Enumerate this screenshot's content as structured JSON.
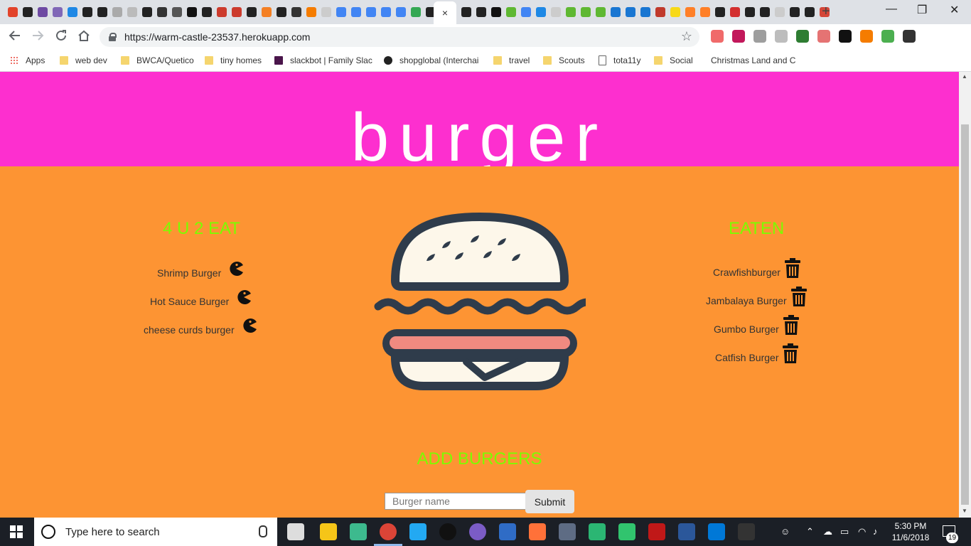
{
  "browser": {
    "url": "https://warm-castle-23537.herokuapp.com",
    "close_tab_glyph": "×",
    "new_tab_glyph": "+",
    "window_controls": {
      "minimize": "—",
      "maximize": "❐",
      "close": "✕"
    },
    "tab_favicon_colors": [
      "#e2432a",
      "#222222",
      "#6e4aa3",
      "#8067b7",
      "#1e88e5",
      "#222222",
      "#222222",
      "#aaaaaa",
      "#bbbbbb",
      "#222222",
      "#333333",
      "#555555",
      "#111111",
      "#222222",
      "#cc3b2d",
      "#cc3b2d",
      "#222222",
      "#f48024",
      "#222222",
      "#333333",
      "#f57c00",
      "#cccccc",
      "#4285f4",
      "#4285f4",
      "#4285f4",
      "#4285f4",
      "#4285f4",
      "#34a853",
      "#222222"
    ],
    "tab_favicon_colors_right": [
      "#222222",
      "#222222",
      "#111111",
      "#5fb832",
      "#4285f4",
      "#1e88e5",
      "#cccccc",
      "#5fb832",
      "#5fb832",
      "#5fb832",
      "#1976d2",
      "#1976d2",
      "#1976d2",
      "#c0392b",
      "#f7d918",
      "#ff7f27",
      "#ff7f27",
      "#222222",
      "#d32f2f",
      "#222222",
      "#222222",
      "#cccccc",
      "#222222",
      "#222222",
      "#d44638"
    ],
    "extension_colors": [
      "#f06a6a",
      "#c2185b",
      "#9e9e9e",
      "#bdbdbd",
      "#2e7d32",
      "#e57373",
      "#111111",
      "#f57c00",
      "#4caf50",
      "#333333"
    ],
    "bookmarks": [
      {
        "label": "Apps",
        "type": "apps"
      },
      {
        "label": "web dev",
        "type": "folder"
      },
      {
        "label": "BWCA/Quetico",
        "type": "folder"
      },
      {
        "label": "tiny homes",
        "type": "folder"
      },
      {
        "label": "slackbot | Family Slac",
        "type": "slack"
      },
      {
        "label": "shopglobal (Interchai",
        "type": "github"
      },
      {
        "label": "travel",
        "type": "folder"
      },
      {
        "label": "Scouts",
        "type": "folder"
      },
      {
        "label": "tota11y",
        "type": "page"
      },
      {
        "label": "Social",
        "type": "folder"
      },
      {
        "label": "Christmas Land and C",
        "type": "none"
      }
    ]
  },
  "page": {
    "title": "burger",
    "uneaten_heading": "4 U 2 EAT",
    "eaten_heading": "EATEN",
    "uneaten": [
      "Shrimp Burger",
      "Hot Sauce Burger",
      "cheese curds burger"
    ],
    "eaten": [
      "Crawfishburger",
      "Jambalaya Burger",
      "Gumbo Burger",
      "Catfish Burger"
    ],
    "add_heading": "ADD BURGERS",
    "input_placeholder": "Burger name",
    "submit_label": "Submit",
    "colors": {
      "jumbotron": "#fd2fcf",
      "main_bg": "#fd9433",
      "heading": "#7cfc00"
    },
    "icons": {
      "eat": "pacman-icon",
      "delete": "trash-icon",
      "hero": "burger-illustration"
    }
  },
  "taskbar": {
    "search_placeholder": "Type here to search",
    "time": "5:30 PM",
    "date": "11/6/2018",
    "notification_count": "19",
    "pinned_app_colors": [
      "#dddddd",
      "#f5c518",
      "#3dba8e",
      "#db4437",
      "#23a9f2",
      "#111111",
      "#7b5cc6",
      "#2f6cc6",
      "#ff7139",
      "#5e6c84",
      "#2bb673",
      "#31c46e",
      "#c01818",
      "#2b579a",
      "#0078d7",
      "#333333"
    ]
  }
}
